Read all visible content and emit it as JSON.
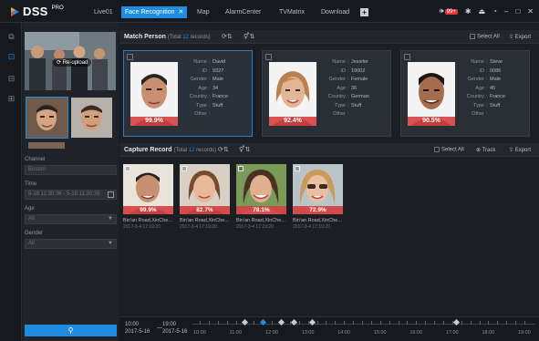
{
  "app": {
    "brand": "DSS",
    "edition": "PRO"
  },
  "tabs": [
    {
      "label": "Live01",
      "active": false
    },
    {
      "label": "Face Recognition",
      "active": true
    },
    {
      "label": "Map",
      "active": false
    },
    {
      "label": "AlarmCenter",
      "active": false
    },
    {
      "label": "TVMatrix",
      "active": false
    },
    {
      "label": "Download",
      "active": false
    }
  ],
  "topbar": {
    "alarm_count": "99+"
  },
  "left_panel": {
    "reupload_label": "Re-upload",
    "channel_label": "Channel",
    "channel_value": "Boston",
    "time_label": "Time",
    "time_value": "5-18 11:30:36 - 5-18 11:30:36",
    "age_label": "Age",
    "age_value": "All",
    "gender_label": "Gender",
    "gender_value": "All"
  },
  "match": {
    "title": "Match Person",
    "total_prefix": "(Total",
    "total_count": "12",
    "total_suffix": "records)",
    "select_all": "Select All",
    "export": "Export",
    "field_labels": [
      "Name :",
      "ID :",
      "Gender :",
      "Age :",
      "Country :",
      "Type :",
      "Other :"
    ],
    "cards": [
      {
        "similarity": "99.9%",
        "values": [
          "David",
          "9327",
          "Male",
          "34",
          "France",
          "Stuff",
          ""
        ],
        "selected": true
      },
      {
        "similarity": "92.4%",
        "values": [
          "Jessifer",
          "19002",
          "Female",
          "36",
          "German",
          "Stuff",
          ""
        ],
        "selected": false
      },
      {
        "similarity": "90.5%",
        "values": [
          "Steve",
          "0086",
          "Male",
          "45",
          "France",
          "Stuff",
          ""
        ],
        "selected": false
      }
    ]
  },
  "capture": {
    "title": "Capture Record",
    "total_prefix": "(Total",
    "total_count": "12",
    "total_suffix": "records)",
    "select_all": "Select All",
    "track": "Track",
    "export": "Export",
    "items": [
      {
        "similarity": "99.9%",
        "address": "Bin'an Road,XinChe...",
        "time": "2017-3-4 17:19:20"
      },
      {
        "similarity": "82.7%",
        "address": "Bin'an Road,XinChe...",
        "time": "2017-3-4 17:19:20"
      },
      {
        "similarity": "78.1%",
        "address": "Bin'an Road,XinChe...",
        "time": "2017-3-4 17:19:20"
      },
      {
        "similarity": "72.9%",
        "address": "Bin'an Road,XinChe...",
        "time": "2017-3-4 17:19:20"
      }
    ]
  },
  "timeline": {
    "start_time": "10:00",
    "start_date": "2017-5-16",
    "end_time": "19:00",
    "end_date": "2017-5-16",
    "labels": [
      "10:00",
      "11:00",
      "12:00",
      "13:00",
      "14:00",
      "15:00",
      "16:00",
      "17:00",
      "18:00",
      "19:00"
    ]
  },
  "colors": {
    "accent": "#1e8de0",
    "similarity_bg": "#d64040",
    "alarm": "#e23b3b"
  }
}
